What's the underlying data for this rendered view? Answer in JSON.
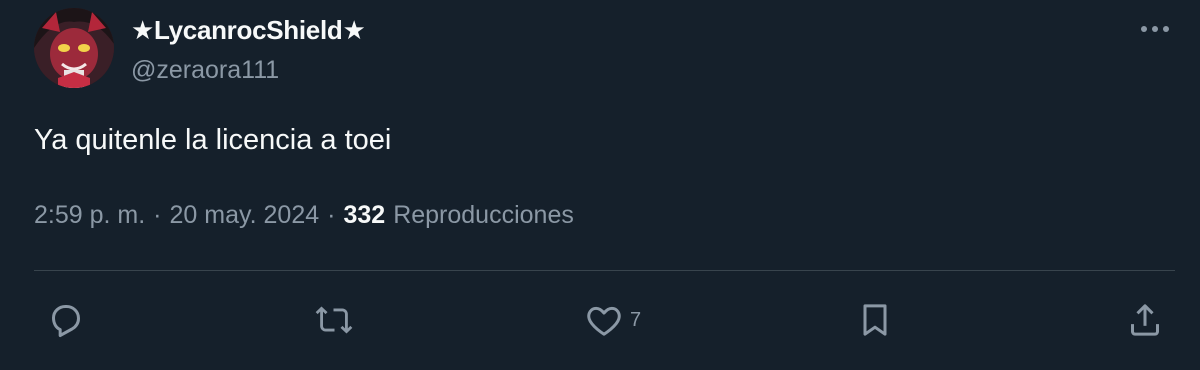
{
  "author": {
    "display_name": "★LycanrocShield★",
    "handle": "@zeraora111"
  },
  "tweet": {
    "text": "Ya quitenle la licencia a toei",
    "time": "2:59 p. m.",
    "separator": "·",
    "date": "20 may. 2024",
    "views_count": "332",
    "views_label": "Reproducciones"
  },
  "actions": {
    "reply_icon": "reply-icon",
    "retweet_icon": "retweet-icon",
    "like_icon": "heart-icon",
    "like_count": "7",
    "bookmark_icon": "bookmark-icon",
    "share_icon": "share-icon"
  },
  "colors": {
    "background": "#15202b",
    "primary_text": "#f7f9f9",
    "secondary_text": "#8b98a5",
    "divider": "#38444d"
  }
}
